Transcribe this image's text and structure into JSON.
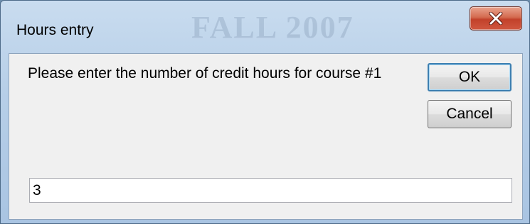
{
  "window": {
    "title": "Hours entry",
    "background_title": "FALL 2007"
  },
  "dialog": {
    "prompt": "Please enter the number of credit hours for course #1",
    "ok_label": "OK",
    "cancel_label": "Cancel",
    "input_value": "3"
  },
  "icons": {
    "close": "close-icon"
  },
  "colors": {
    "close_button": "#c2412a",
    "default_button_border": "#3c7fb1",
    "dialog_background": "#f0f0f0"
  }
}
